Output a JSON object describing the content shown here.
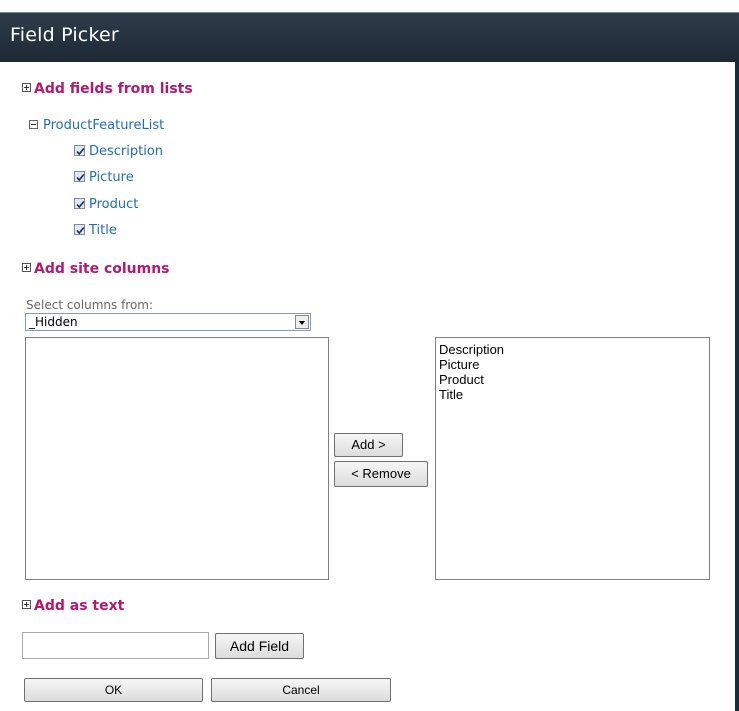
{
  "dialog": {
    "title": "Field Picker"
  },
  "sections": {
    "lists_header": "Add fields from lists",
    "site_columns_header": "Add site columns",
    "as_text_header": "Add as text"
  },
  "tree": {
    "list_name": "ProductFeatureList",
    "fields": [
      {
        "label": "Description",
        "checked": true
      },
      {
        "label": "Picture",
        "checked": true
      },
      {
        "label": "Product",
        "checked": true
      },
      {
        "label": "Title",
        "checked": true
      }
    ]
  },
  "site_columns": {
    "select_label": "Select columns from:",
    "selected_group": "_Hidden",
    "available": [],
    "selected_columns": [
      "Description",
      "Picture",
      "Product",
      "Title"
    ],
    "add_label": "Add >",
    "remove_label": "< Remove"
  },
  "as_text": {
    "value": "",
    "add_field_label": "Add Field"
  },
  "footer": {
    "ok_label": "OK",
    "cancel_label": "Cancel"
  }
}
